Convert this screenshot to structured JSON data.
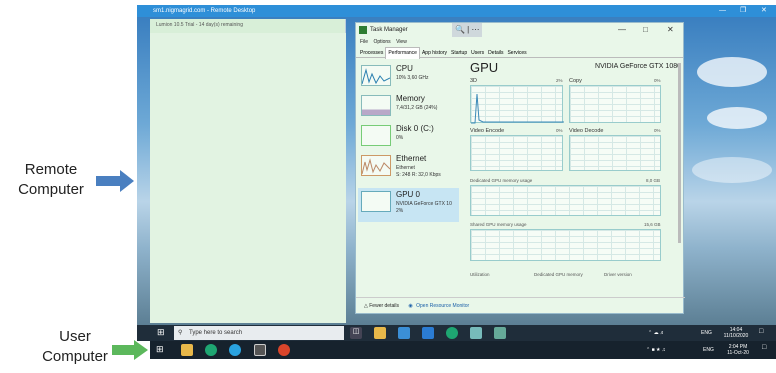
{
  "labels": {
    "remote_line1": "Remote",
    "remote_line2": "Computer",
    "user_line1": "User",
    "user_line2": "Computer"
  },
  "remote_window": {
    "title": "sm1.nigmagrid.com - Remote Desktop",
    "lumion_title": "Lumion 10.5 Trial - 14 day(s) remaining"
  },
  "task_manager": {
    "title": "Task Manager",
    "menu": [
      "File",
      "Options",
      "View"
    ],
    "tabs": [
      "Processes",
      "Performance",
      "App history",
      "Startup",
      "Users",
      "Details",
      "Services"
    ],
    "selected_tab": "Performance",
    "sidebar": [
      {
        "name": "CPU",
        "sub1": "10% 3,60 GHz",
        "sub2": ""
      },
      {
        "name": "Memory",
        "sub1": "7,4/31,2 GB (24%)",
        "sub2": ""
      },
      {
        "name": "Disk 0 (C:)",
        "sub1": "0%",
        "sub2": ""
      },
      {
        "name": "Ethernet",
        "sub1": "Ethernet",
        "sub2": "S: 248  R: 32,0 Kbps"
      },
      {
        "name": "GPU 0",
        "sub1": "NVIDIA GeForce GTX 10",
        "sub2": "2%"
      }
    ],
    "gpu": {
      "title": "GPU",
      "model": "NVIDIA GeForce GTX 1080",
      "engines": [
        {
          "name": "3D",
          "value": "2%"
        },
        {
          "name": "Copy",
          "value": "0%"
        },
        {
          "name": "Video Encode",
          "value": "0%"
        },
        {
          "name": "Video Decode",
          "value": "0%"
        }
      ],
      "dedicated_label": "Dedicated GPU memory usage",
      "dedicated_value": "8,0 GB",
      "shared_label": "Shared GPU memory usage",
      "shared_value": "15,6 GB",
      "bottom_labels": [
        "Utilization",
        "Dedicated GPU memory",
        "Driver version"
      ]
    },
    "footer": {
      "fewer": "Fewer details",
      "open": "Open Resource Monitor"
    }
  },
  "remote_taskbar": {
    "search_placeholder": "Type here to search",
    "lang": "ENG",
    "time": "14:04",
    "date": "11/10/2020"
  },
  "user_taskbar": {
    "lang": "ENG",
    "time": "2:04 PM",
    "date": "11-Oct-20"
  }
}
